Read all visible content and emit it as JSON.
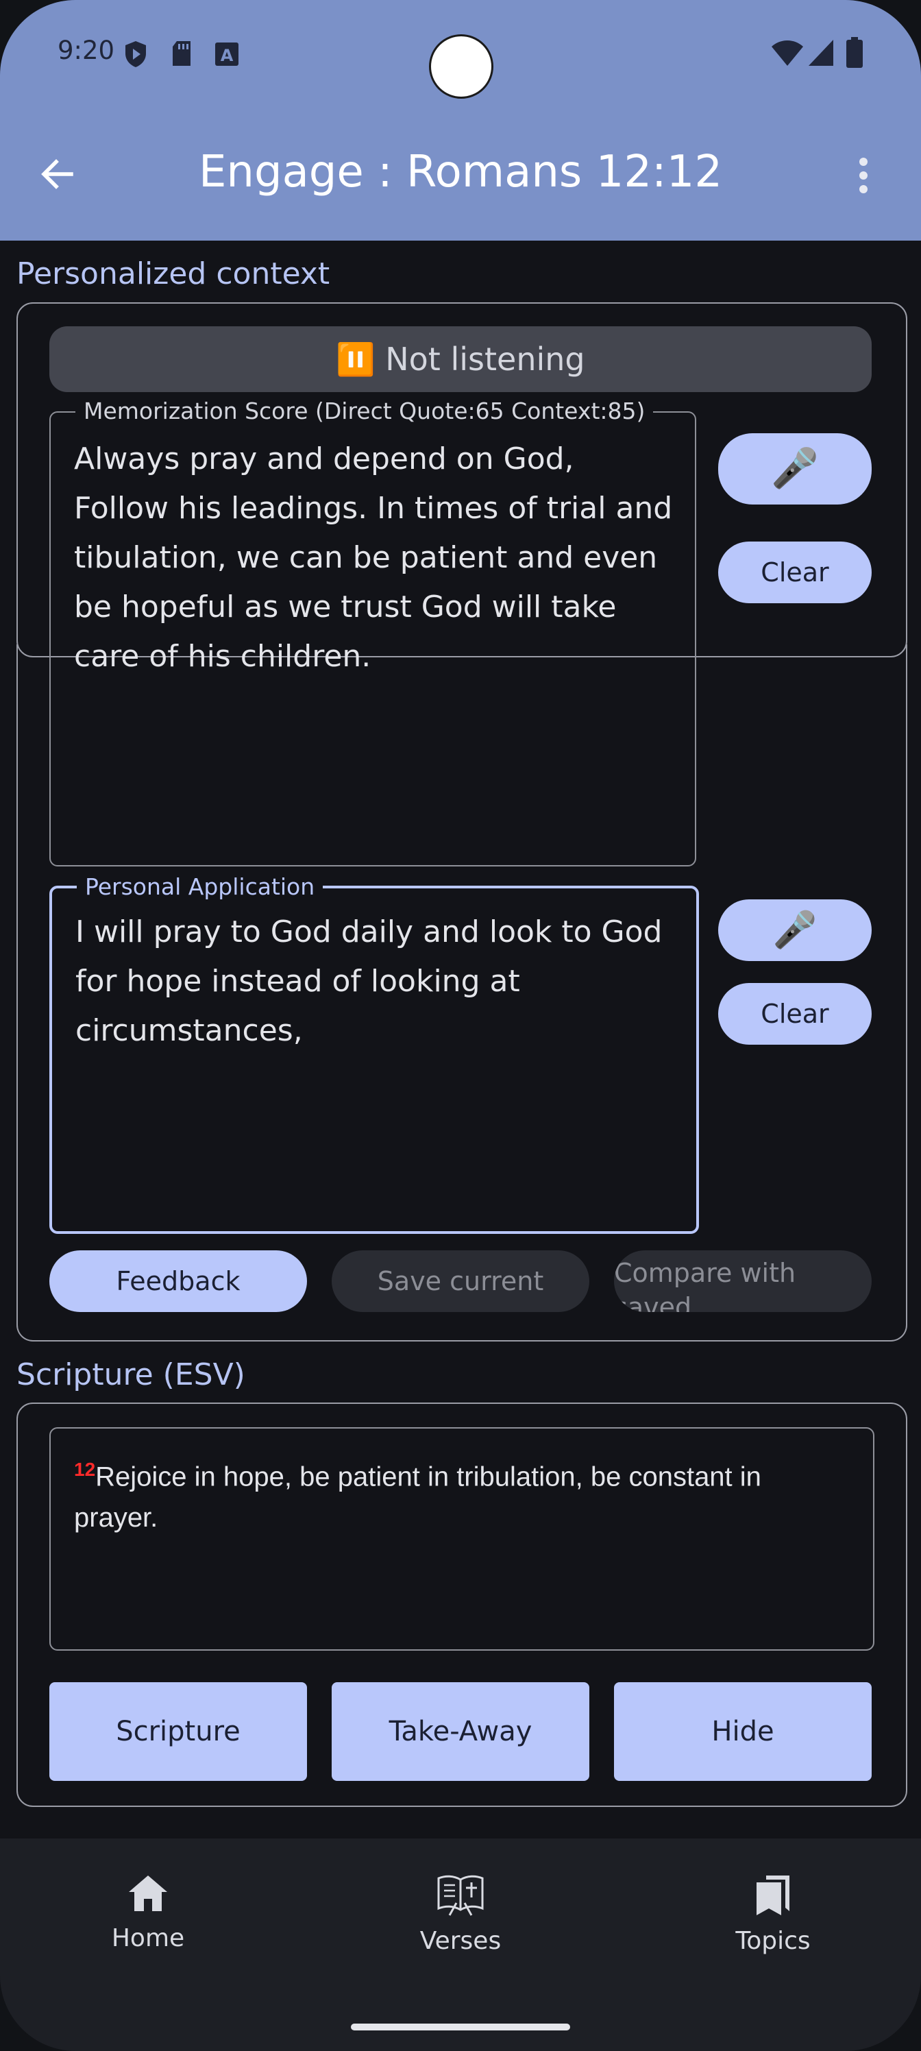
{
  "status_bar": {
    "time": "9:20",
    "icons": [
      "play-protect-icon",
      "sd-card-icon",
      "a-box-icon",
      "wifi-icon",
      "signal-icon",
      "battery-icon"
    ]
  },
  "app_bar": {
    "title": "Engage : Romans 12:12",
    "back_icon": "back-arrow-icon",
    "menu_icon": "more-vert-icon"
  },
  "personalized": {
    "section_label": "Personalized context",
    "listening_status": "⏸️ Not listening",
    "memorization": {
      "label": "Memorization Score (Direct Quote:65 Context:85)",
      "text": "Always pray and depend on God, Follow his leadings. In times of trial and tibulation, we can be patient and even be hopeful as we trust God will take care of his children.",
      "mic_label": "🎤",
      "clear_label": "Clear"
    },
    "application": {
      "label": "Personal Application",
      "text": "I will pray to God daily and look to God for hope instead of looking at circumstances,",
      "mic_label": "🎤",
      "clear_label": "Clear"
    },
    "actions": {
      "feedback": "Feedback",
      "save_current": "Save current",
      "compare_line1": "Compare with",
      "compare_line2": "saved"
    }
  },
  "scripture": {
    "section_label": "Scripture (ESV)",
    "verse_number": "12",
    "verse_text": "Rejoice in hope, be patient in tribulation, be constant in prayer.",
    "buttons": {
      "scripture": "Scripture",
      "takeaway": "Take-Away",
      "hide": "Hide"
    }
  },
  "bottom_nav": [
    {
      "label": "Home",
      "icon": "home-icon"
    },
    {
      "label": "Verses",
      "icon": "book-icon"
    },
    {
      "label": "Topics",
      "icon": "bookmarks-icon"
    }
  ],
  "colors": {
    "app_bar": "#7b91c8",
    "background": "#121318",
    "accent": "#b9c7fb",
    "section_label": "#b6c4f3",
    "verse_number": "#ff2a2a"
  }
}
